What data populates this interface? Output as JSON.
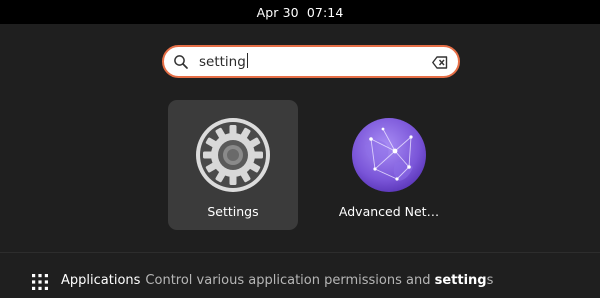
{
  "topbar": {
    "clock": "Apr 30  07:14"
  },
  "search": {
    "value": "setting",
    "clear_icon": "edit-clear-icon",
    "search_icon": "search-icon"
  },
  "results": [
    {
      "label": "Settings",
      "icon": "gear-icon",
      "selected": true
    },
    {
      "label": "Advanced Net…",
      "icon": "network-globe-icon",
      "selected": false
    }
  ],
  "provider": {
    "name": "Applications",
    "desc_before": "Control various application permissions and ",
    "desc_match": "setting",
    "desc_after": "s",
    "icon": "app-grid-icon"
  },
  "colors": {
    "accent": "#e66f47",
    "background": "#1f1f1f",
    "topbar": "#000000",
    "selected_tile": "#3b3b3b"
  }
}
